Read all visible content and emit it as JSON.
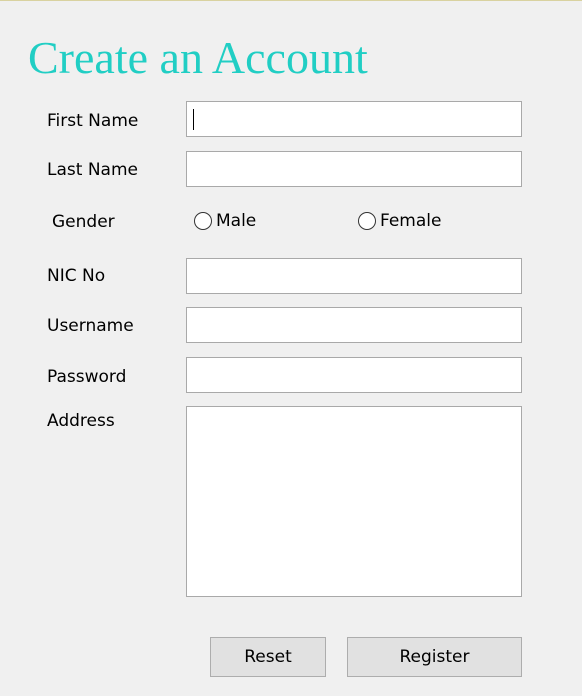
{
  "form": {
    "title": "Create an Account",
    "first_name": {
      "label": "First Name",
      "value": ""
    },
    "last_name": {
      "label": "Last Name",
      "value": ""
    },
    "gender": {
      "label": "Gender",
      "options": [
        "Male",
        "Female"
      ],
      "selected": null
    },
    "nic_no": {
      "label": "NIC No",
      "value": ""
    },
    "username": {
      "label": "Username",
      "value": ""
    },
    "password": {
      "label": "Password",
      "value": ""
    },
    "address": {
      "label": "Address",
      "value": ""
    }
  },
  "buttons": {
    "reset_label": "Reset",
    "register_label": "Register"
  }
}
